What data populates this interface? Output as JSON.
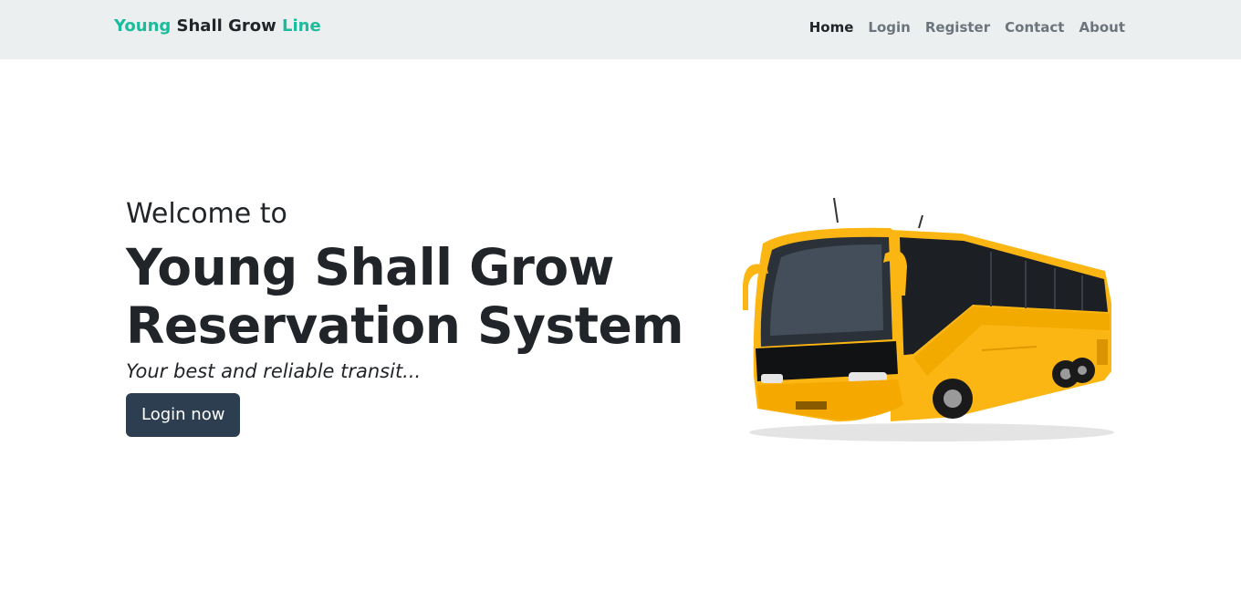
{
  "navbar": {
    "brand": {
      "part1": "Young",
      "part2": " Shall Grow ",
      "part3": "Line"
    },
    "links": [
      {
        "label": "Home",
        "active": true
      },
      {
        "label": "Login",
        "active": false
      },
      {
        "label": "Register",
        "active": false
      },
      {
        "label": "Contact",
        "active": false
      },
      {
        "label": "About",
        "active": false
      }
    ]
  },
  "hero": {
    "welcome": "Welcome to",
    "title_line1": "Young Shall Grow",
    "title_line2": "Reservation System",
    "tagline": "Your best and reliable transit...",
    "button_label": "Login now",
    "image": "bus-image"
  },
  "colors": {
    "brand_accent": "#1abc9c",
    "navbar_bg": "#ecefef",
    "button_bg": "#2c3e50",
    "bus_body": "#fbb614"
  }
}
